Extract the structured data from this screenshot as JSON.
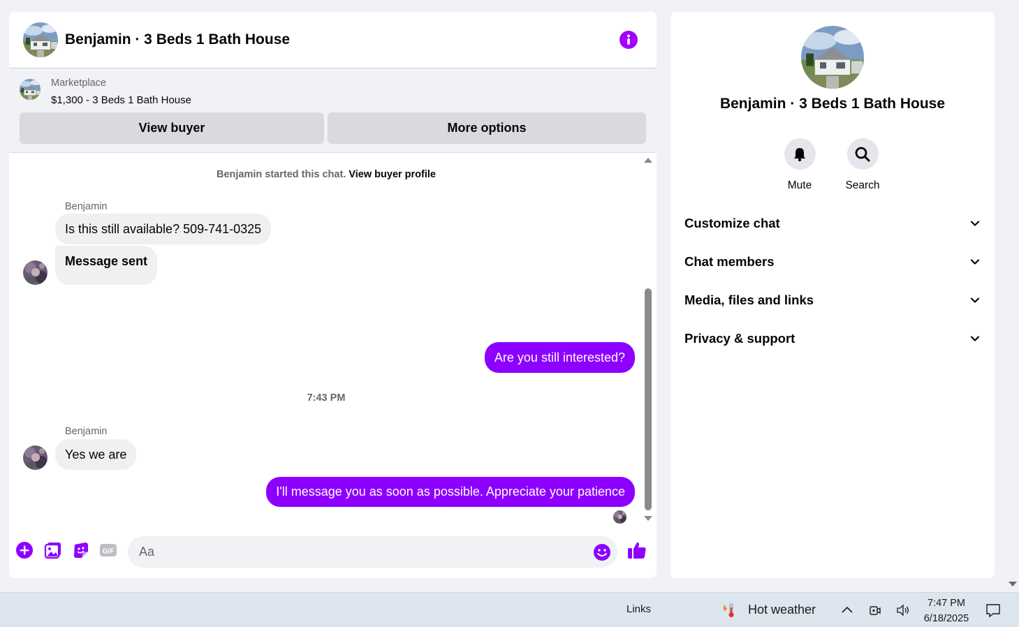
{
  "chat": {
    "title": "Benjamin · 3 Beds 1 Bath House",
    "marketplace_label": "Marketplace",
    "listing": "$1,300 - 3 Beds 1 Bath House",
    "view_buyer_label": "View buyer",
    "more_options_label": "More options",
    "started_text": "Benjamin started this chat.",
    "view_profile_link": "View buyer profile",
    "messages": [
      {
        "sender": "Benjamin",
        "text": "Is this still available? 509-741-0325",
        "direction": "in"
      },
      {
        "text": "Message sent",
        "direction": "in"
      },
      {
        "text": "Are you still interested?",
        "direction": "out"
      },
      {
        "timestamp": "7:43 PM"
      },
      {
        "sender": "Benjamin",
        "text": "Yes we are",
        "direction": "in"
      },
      {
        "text": "I'll message you as soon as possible. Appreciate your patience",
        "direction": "out"
      }
    ],
    "input_placeholder": "Aa",
    "accent_color": "#8d00ff"
  },
  "info": {
    "title": "Benjamin · 3 Beds 1 Bath House",
    "mute_label": "Mute",
    "search_label": "Search",
    "sections": [
      {
        "label": "Customize chat"
      },
      {
        "label": "Chat members"
      },
      {
        "label": "Media, files and links"
      },
      {
        "label": "Privacy & support"
      }
    ]
  },
  "taskbar": {
    "links_label": "Links",
    "weather_label": "Hot weather",
    "time": "7:47 PM",
    "date": "6/18/2025"
  }
}
